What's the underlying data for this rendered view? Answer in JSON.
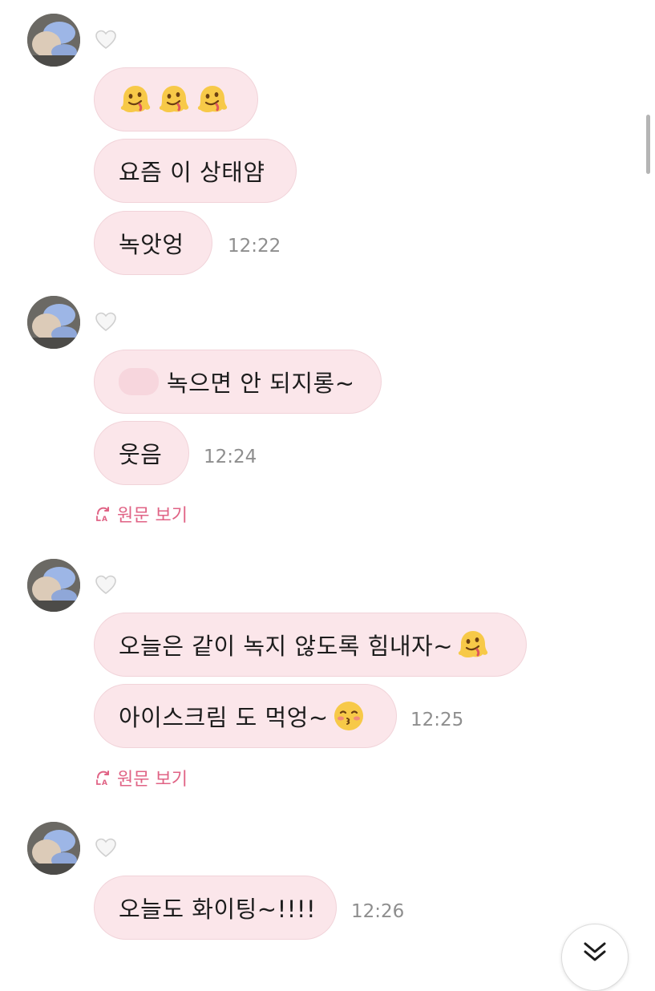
{
  "messages": [
    {
      "bubbles": [
        {
          "emoji": [
            "melting-face-emoji",
            "melting-face-emoji",
            "melting-face-emoji"
          ]
        },
        {
          "text": "요즘 이 상태얌"
        },
        {
          "text": "녹앗엉"
        }
      ],
      "time": "12:22"
    },
    {
      "bubbles": [
        {
          "text": "녹으면 안 되지롱~"
        },
        {
          "text": "웃음"
        }
      ],
      "time": "12:24",
      "original_link": "원문 보기"
    },
    {
      "bubbles": [
        {
          "text": "오늘은 같이 녹지 않도록 힘내자~",
          "trailing_emoji": "melting-face-emoji"
        },
        {
          "text": "아이스크림 도 먹엉~",
          "trailing_emoji": "kissing-face-emoji"
        }
      ],
      "time": "12:25",
      "original_link": "원문 보기"
    },
    {
      "bubbles": [
        {
          "text": "오늘도 화이팅~!!!!"
        }
      ],
      "time": "12:26"
    }
  ],
  "colors": {
    "bubble_bg": "#fbe6ea",
    "link": "#e06385",
    "timestamp": "#8e8e8e"
  },
  "icons": {
    "heart": "heart-outline-icon",
    "original": "translate-refresh-icon",
    "scroll": "double-chevron-down-icon"
  }
}
